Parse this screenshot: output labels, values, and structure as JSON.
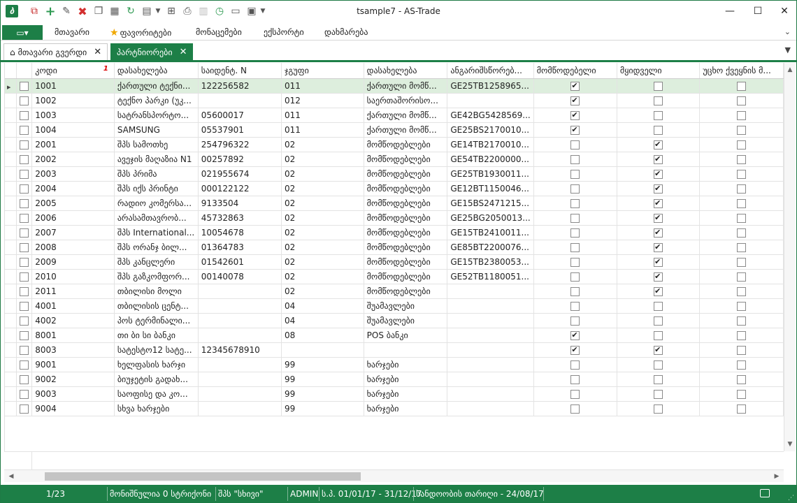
{
  "window": {
    "title": "tsample7 - AS-Trade"
  },
  "toolbar": {
    "icons": [
      "delete-filtered-icon",
      "add-icon",
      "edit-icon",
      "delete-icon",
      "copy-icon",
      "grid-icon",
      "refresh-icon",
      "view-icon",
      "print-preview-icon",
      "print-icon",
      "export-icon",
      "history-icon",
      "window-icon",
      "form-icon"
    ]
  },
  "menu": {
    "file_icon": "▭▾",
    "items": [
      "მთავარი",
      "ფავორიტები",
      "მონაცემები",
      "ექსპორტი",
      "დახმარება"
    ]
  },
  "tabs": [
    {
      "label": "მთავარი გვერდი",
      "active": false
    },
    {
      "label": "პარტნიორები",
      "active": true
    }
  ],
  "grid": {
    "columns": [
      "კოდი",
      "დასახელება",
      "საიდენტ. N",
      "ჯგუფი",
      "დასახელება",
      "ანგარიშსწორებ...",
      "მომწოდებელი",
      "მყიდველი",
      "უცხო ქვეყნის მ..."
    ],
    "sort_indicator": "1",
    "rows": [
      {
        "code": "1001",
        "name": "ქართული ტექნი...",
        "id": "122256582",
        "group": "011",
        "gname": "ქართული მომწ...",
        "account": "GE25TB1258965...",
        "supplier": true,
        "buyer": false,
        "foreign": false
      },
      {
        "code": "1002",
        "name": "ტექნო პარკი (უკ...",
        "id": "",
        "group": "012",
        "gname": "საერთაშორისო...",
        "account": "",
        "supplier": true,
        "buyer": false,
        "foreign": false
      },
      {
        "code": "1003",
        "name": "სატრანსპორტო...",
        "id": "05600017",
        "group": "011",
        "gname": "ქართული მომწ...",
        "account": "GE42BG5428569...",
        "supplier": true,
        "buyer": false,
        "foreign": false
      },
      {
        "code": "1004",
        "name": "SAMSUNG",
        "id": "05537901",
        "group": "011",
        "gname": "ქართული მომწ...",
        "account": "GE25BS2170010...",
        "supplier": true,
        "buyer": false,
        "foreign": false
      },
      {
        "code": "2001",
        "name": "შპს სამოთხე",
        "id": "254796322",
        "group": "02",
        "gname": "მომწოდებლები",
        "account": "GE14TB2170010...",
        "supplier": false,
        "buyer": true,
        "foreign": false
      },
      {
        "code": "2002",
        "name": "ავეჯის მაღაზია N1",
        "id": "00257892",
        "group": "02",
        "gname": "მომწოდებლები",
        "account": "GE54TB2200000...",
        "supplier": false,
        "buyer": true,
        "foreign": false
      },
      {
        "code": "2003",
        "name": "შპს პრიმა",
        "id": "021955674",
        "group": "02",
        "gname": "მომწოდებლები",
        "account": "GE25TB1930011...",
        "supplier": false,
        "buyer": true,
        "foreign": false
      },
      {
        "code": "2004",
        "name": "შპს იქს პრინტი",
        "id": "000122122",
        "group": "02",
        "gname": "მომწოდებლები",
        "account": "GE12BT1150046...",
        "supplier": false,
        "buyer": true,
        "foreign": false
      },
      {
        "code": "2005",
        "name": "რადიო კომერსა...",
        "id": "9133504",
        "group": "02",
        "gname": "მომწოდებლები",
        "account": "GE15BS2471215...",
        "supplier": false,
        "buyer": true,
        "foreign": false
      },
      {
        "code": "2006",
        "name": "არასამთავრობ...",
        "id": "45732863",
        "group": "02",
        "gname": "მომწოდებლები",
        "account": "GE25BG2050013...",
        "supplier": false,
        "buyer": true,
        "foreign": false
      },
      {
        "code": "2007",
        "name": "შპს International...",
        "id": "10054678",
        "group": "02",
        "gname": "მომწოდებლები",
        "account": "GE15TB2410011...",
        "supplier": false,
        "buyer": true,
        "foreign": false
      },
      {
        "code": "2008",
        "name": "შპს ორანჯ ბილ...",
        "id": "01364783",
        "group": "02",
        "gname": "მომწოდებლები",
        "account": "GE85BT2200076...",
        "supplier": false,
        "buyer": true,
        "foreign": false
      },
      {
        "code": "2009",
        "name": "შპს კანცლერი",
        "id": "01542601",
        "group": "02",
        "gname": "მომწოდებლები",
        "account": "GE15TB2380053...",
        "supplier": false,
        "buyer": true,
        "foreign": false
      },
      {
        "code": "2010",
        "name": "შპს გაზკომფორ...",
        "id": "00140078",
        "group": "02",
        "gname": "მომწოდებლები",
        "account": "GE52TB1180051...",
        "supplier": false,
        "buyer": true,
        "foreign": false
      },
      {
        "code": "2011",
        "name": "თბილისი მოლი",
        "id": "",
        "group": "02",
        "gname": "მომწოდებლები",
        "account": "",
        "supplier": false,
        "buyer": true,
        "foreign": false
      },
      {
        "code": "4001",
        "name": "თბილისის ცენტ...",
        "id": "",
        "group": "04",
        "gname": "შუამავლები",
        "account": "",
        "supplier": false,
        "buyer": false,
        "foreign": false
      },
      {
        "code": "4002",
        "name": "პოს ტერმინალი...",
        "id": "",
        "group": "04",
        "gname": "შუამავლები",
        "account": "",
        "supplier": false,
        "buyer": false,
        "foreign": false
      },
      {
        "code": "8001",
        "name": "თი ბი სი ბანკი",
        "id": "",
        "group": "08",
        "gname": "POS ბანკი",
        "account": "",
        "supplier": true,
        "buyer": false,
        "foreign": false
      },
      {
        "code": "8003",
        "name": "სატესტო12 სატე...",
        "id": "12345678910",
        "group": "",
        "gname": "",
        "account": "",
        "supplier": true,
        "buyer": true,
        "foreign": false
      },
      {
        "code": "9001",
        "name": "ხელფასის ხარჯი",
        "id": "",
        "group": "99",
        "gname": "ხარჯები",
        "account": "",
        "supplier": false,
        "buyer": false,
        "foreign": false
      },
      {
        "code": "9002",
        "name": "ბიუჯეტის გადახ...",
        "id": "",
        "group": "99",
        "gname": "ხარჯები",
        "account": "",
        "supplier": false,
        "buyer": false,
        "foreign": false
      },
      {
        "code": "9003",
        "name": "საოფისე და კო...",
        "id": "",
        "group": "99",
        "gname": "ხარჯები",
        "account": "",
        "supplier": false,
        "buyer": false,
        "foreign": false
      },
      {
        "code": "9004",
        "name": "სხვა ხარჯები",
        "id": "",
        "group": "99",
        "gname": "ხარჯები",
        "account": "",
        "supplier": false,
        "buyer": false,
        "foreign": false
      }
    ]
  },
  "status": {
    "position": "1/23",
    "selected": "მონიშნულია 0 სტრიქონი",
    "company": "შპს \"სხივი\"",
    "user": "ADMIN",
    "period": "ს.პ. 01/01/17 - 31/12/17",
    "date": "სანდოობის თარიღი - 24/08/17"
  },
  "colors": {
    "accent": "#1d7f47",
    "selected_row": "#ddeedd"
  }
}
